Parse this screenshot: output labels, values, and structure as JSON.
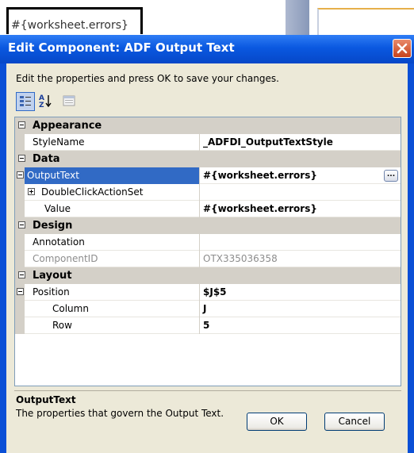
{
  "worksheet": {
    "cell_text": "#{worksheet.errors}"
  },
  "dialog": {
    "title": "Edit Component: ADF Output Text",
    "instructions": "Edit the properties and press OK to save your changes.",
    "toolbar": {
      "categorized_icon": "categorized-view-icon",
      "alphabetical_icon": "alphabetical-sort-icon",
      "property_pages_icon": "property-pages-icon"
    },
    "categories": {
      "appearance": "Appearance",
      "data": "Data",
      "design": "Design",
      "layout": "Layout"
    },
    "properties": {
      "stylename": {
        "name": "StyleName",
        "value": "_ADFDI_OutputTextStyle"
      },
      "outputtext": {
        "name": "OutputText",
        "value": "#{worksheet.errors}",
        "button": "..."
      },
      "doubleclick": {
        "name": "DoubleClickActionSet",
        "value": ""
      },
      "value": {
        "name": "Value",
        "value": "#{worksheet.errors}"
      },
      "annotation": {
        "name": "Annotation",
        "value": ""
      },
      "componentid": {
        "name": "ComponentID",
        "value": "OTX335036358"
      },
      "position": {
        "name": "Position",
        "value": "$J$5"
      },
      "column": {
        "name": "Column",
        "value": "J"
      },
      "row": {
        "name": "Row",
        "value": "5"
      }
    },
    "description": {
      "title": "OutputText",
      "text": "The properties that govern the Output Text."
    },
    "buttons": {
      "ok": "OK",
      "cancel": "Cancel"
    },
    "colors": {
      "title_blue": "#0a58e0",
      "selection": "#316ac5",
      "face": "#ece9d8"
    }
  }
}
